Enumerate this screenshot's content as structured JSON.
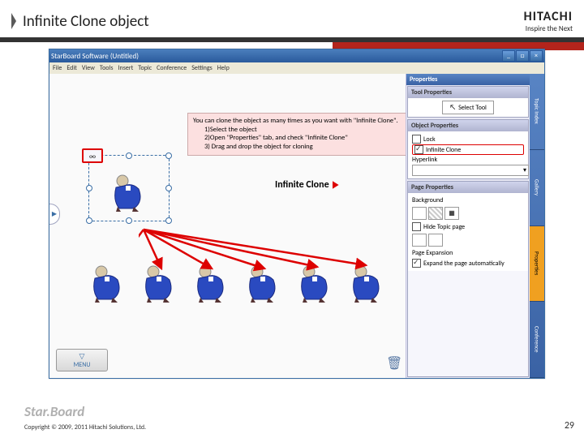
{
  "slide": {
    "title": "Infinite Clone object",
    "brand_main": "HITACHI",
    "brand_tag": "Inspire the Next",
    "footer_logo": "Star.Board",
    "copyright": "Copyright © 2009, 2011 Hitachi Solutions, Ltd.",
    "page": "29"
  },
  "window": {
    "title": "StarBoard Software (Untitled)",
    "menus": [
      "File",
      "Edit",
      "View",
      "Tools",
      "Insert",
      "Topic",
      "Conference",
      "Settings",
      "Help"
    ]
  },
  "canvas": {
    "infinity_symbol": "∞",
    "menu_btn": "MENU",
    "nav_arrow": "▶",
    "trash": "🗑"
  },
  "instruction": {
    "line1": "You can clone the object as many times as you want with \"Infinite Clone\".",
    "step1": "1)Select the object",
    "step2": "2)Open \"Properties\" tab, and check \"Infinite Clone\"",
    "step3": "3) Drag and drop the object for cloning"
  },
  "clone_label": "Infinite Clone",
  "sidebar": {
    "header": "Properties",
    "strip_tabs": [
      "Topic Index",
      "Gallery",
      "Properties",
      "Conference"
    ],
    "tool_props": {
      "title": "Tool Properties",
      "label": "Select Tool"
    },
    "object_props": {
      "title": "Object Properties",
      "lock": "Lock",
      "infinite": "Infinite Clone",
      "hyperlink": "Hyperlink"
    },
    "page_props": {
      "title": "Page Properties",
      "background": "Background",
      "hide": "Hide Topic page",
      "expansion": "Page Expansion",
      "expand_auto": "Expand the page automatically"
    }
  }
}
